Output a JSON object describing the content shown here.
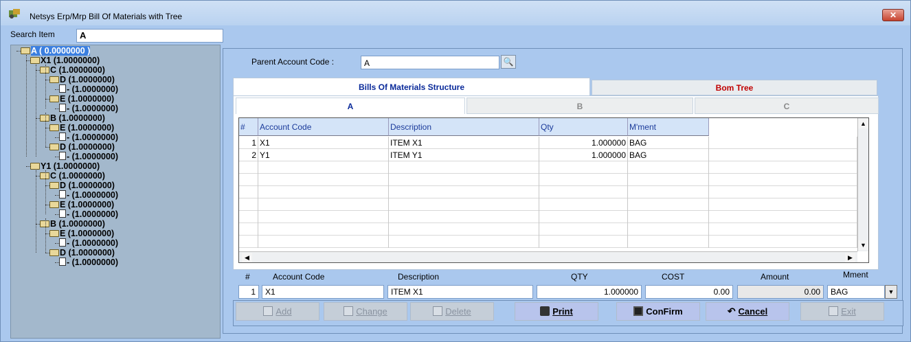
{
  "window": {
    "title": "Netsys Erp/Mrp  Bill Of Materials with Tree",
    "close_label": "✕"
  },
  "search": {
    "label": "Search Item",
    "value": "A"
  },
  "tree": {
    "root": "A      (   0.0000000  )",
    "nodes": [
      "X1  (1.0000000)",
      "C  (1.0000000)",
      "D  (1.0000000)",
      "-  (1.0000000)",
      "E  (1.0000000)",
      "-  (1.0000000)",
      "B  (1.0000000)",
      "E  (1.0000000)",
      "-  (1.0000000)",
      "D  (1.0000000)",
      "-  (1.0000000)",
      "Y1  (1.0000000)",
      "C  (1.0000000)",
      "D  (1.0000000)",
      "-  (1.0000000)",
      "E  (1.0000000)",
      "-  (1.0000000)",
      "B  (1.0000000)",
      "E  (1.0000000)",
      "-  (1.0000000)",
      "D  (1.0000000)",
      "-  (1.0000000)"
    ]
  },
  "parent": {
    "label": "Parent Account Code :",
    "value": "A"
  },
  "tabs": {
    "structure": "Bills Of Materials Structure",
    "tree": "Bom Tree"
  },
  "subtabs": [
    "A",
    "B",
    "C"
  ],
  "grid": {
    "headers": [
      "#",
      "Account Code",
      "Description",
      "Qty",
      "M'ment"
    ],
    "rows": [
      [
        "1",
        "X1",
        "ITEM X1",
        "1.000000",
        "BAG"
      ],
      [
        "2",
        "Y1",
        "ITEM Y1",
        "1.000000",
        "BAG"
      ]
    ]
  },
  "editor": {
    "headers": {
      "num": "#",
      "account": "Account Code",
      "description": "Description",
      "qty": "QTY",
      "cost": "COST",
      "amount": "Amount",
      "mment": "Mment"
    },
    "values": {
      "num": "1",
      "account": "X1",
      "description": "ITEM X1",
      "qty": "1.000000",
      "cost": "0.00",
      "amount": "0.00",
      "mment": "BAG"
    }
  },
  "buttons": {
    "add": "Add",
    "change": "Change",
    "delete": "Delete",
    "print": "Print",
    "confirm": "ConFirm",
    "cancel": "Cancel",
    "exit": "Exit"
  },
  "colors": {
    "background": "#aac8ee",
    "tree_bg": "#a3b8cc",
    "selection": "#3b7fe0",
    "tab_active": "#0a2a9a",
    "tab_tree": "#c00000"
  }
}
